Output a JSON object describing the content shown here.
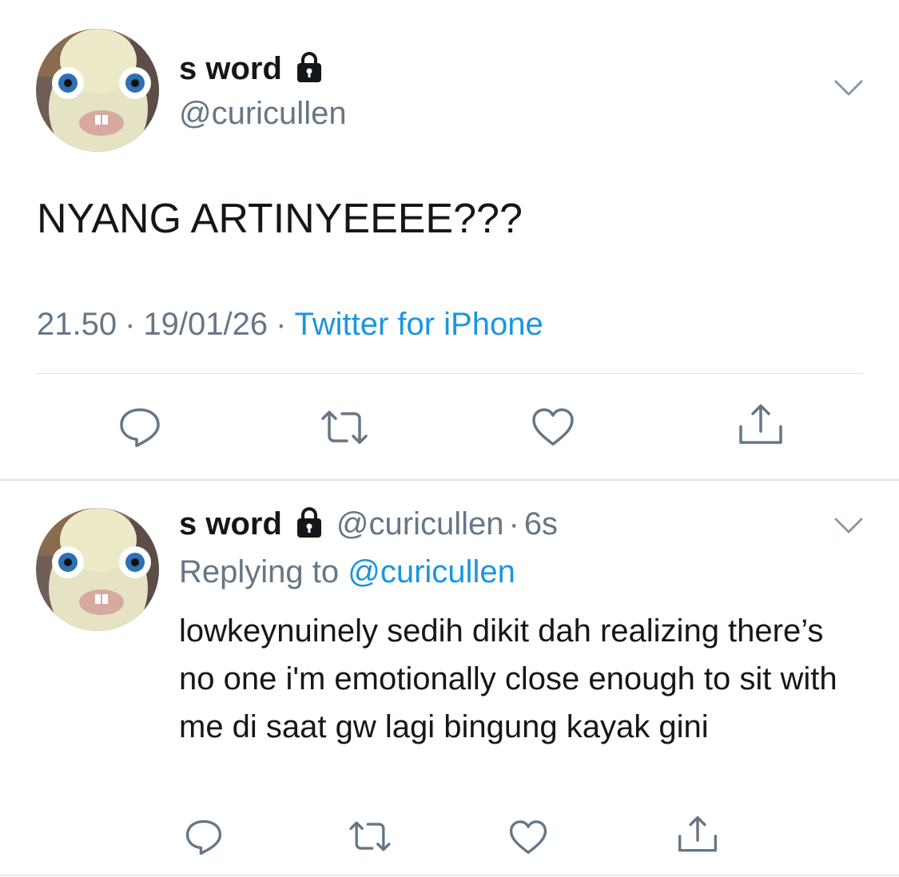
{
  "tweet": {
    "display_name": "s word",
    "handle": "@curicullen",
    "text": "NYANG ARTINYEEEE???",
    "time": "21.50",
    "date": "19/01/26",
    "separator": "·",
    "source": "Twitter for iPhone",
    "icons": [
      "lock-icon",
      "chevron-down-icon",
      "reply-icon",
      "retweet-icon",
      "like-icon",
      "share-icon"
    ]
  },
  "reply": {
    "display_name": "s word",
    "handle": "@curicullen",
    "separator": "·",
    "age": "6s",
    "replying_to_label": "Replying to",
    "replying_to_handle": "@curicullen",
    "text": "lowkeynuinely sedih dikit dah realizing there’s no one i'm emotionally close enough to sit with me di saat gw lagi bingung kayak gini"
  },
  "colors": {
    "text_primary": "#14171a",
    "text_secondary": "#657786",
    "link_blue": "#1b95e0",
    "divider": "#e1e6ea"
  }
}
